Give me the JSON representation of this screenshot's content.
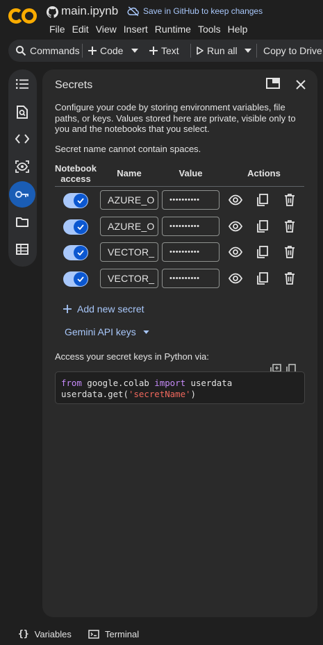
{
  "header": {
    "logo_text": "CO",
    "notebook_title": "main.ipynb",
    "save_github": "Save in GitHub to keep changes"
  },
  "menu": [
    "File",
    "Edit",
    "View",
    "Insert",
    "Runtime",
    "Tools",
    "Help"
  ],
  "toolbar": {
    "commands": "Commands",
    "code": "Code",
    "text": "Text",
    "run_all": "Run all",
    "copy_to_drive": "Copy to Drive"
  },
  "rail": {
    "items": [
      "table-of-contents",
      "find-replace",
      "code-snippets",
      "variable-inspector",
      "secrets",
      "files",
      "data-tables"
    ],
    "active": "secrets"
  },
  "panel": {
    "title": "Secrets",
    "description": "Configure your code by storing environment variables, file paths, or keys. Values stored here are private, visible only to you and the notebooks that you select.",
    "warning": "Secret name cannot contain spaces.",
    "columns": {
      "access_line1": "Notebook",
      "access_line2": "access",
      "name": "Name",
      "value": "Value",
      "actions": "Actions"
    },
    "secrets": [
      {
        "name": "AZURE_O",
        "value": "••••••••••",
        "access": true
      },
      {
        "name": "AZURE_O",
        "value": "••••••••••",
        "access": true
      },
      {
        "name": "VECTOR_",
        "value": "••••••••••",
        "access": true
      },
      {
        "name": "VECTOR_",
        "value": "••••••••••",
        "access": true
      }
    ],
    "add_secret": "Add new secret",
    "gemini_keys": "Gemini API keys",
    "access_label": "Access your secret keys in Python via:",
    "code": {
      "line1_kw1": "from",
      "line1_mod": " google.colab ",
      "line1_kw2": "import",
      "line1_rest": " userdata",
      "line2_pre": "userdata.get(",
      "line2_str": "'secretName'",
      "line2_post": ")"
    }
  },
  "bottom": {
    "variables": "Variables",
    "terminal": "Terminal"
  },
  "colors": {
    "accent": "#a8c7fa",
    "toggle_on": "#0b57d0",
    "logo_orange": "#f9ab00"
  }
}
